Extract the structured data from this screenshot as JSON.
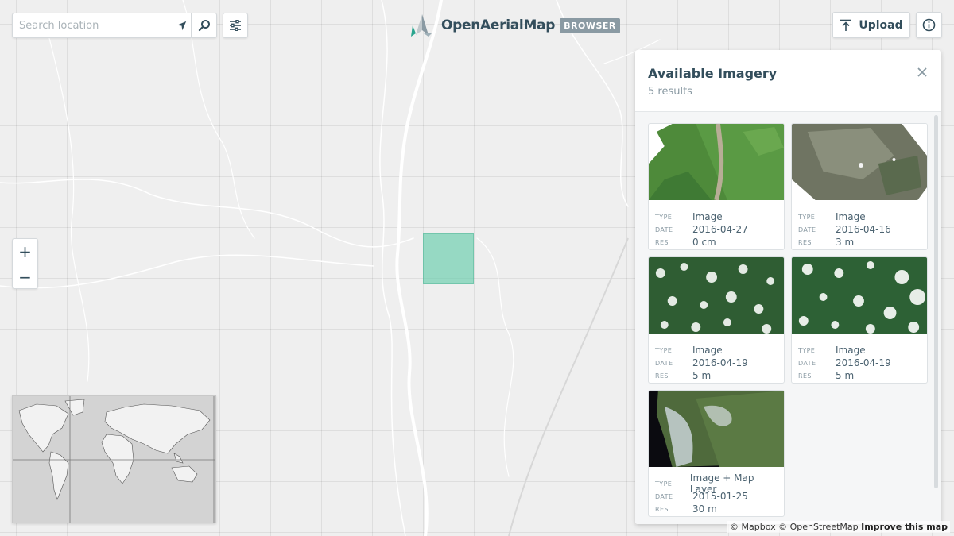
{
  "search": {
    "placeholder": "Search location"
  },
  "brand": {
    "title": "OpenAerialMap",
    "badge": "BROWSER"
  },
  "header": {
    "upload_label": "Upload"
  },
  "panel": {
    "title": "Available Imagery",
    "results": "5 results",
    "labels": {
      "type": "TYPE",
      "date": "DATE",
      "res": "RES"
    },
    "items": [
      {
        "type": "Image",
        "date": "2016-04-27",
        "res": "0 cm"
      },
      {
        "type": "Image",
        "date": "2016-04-16",
        "res": "3 m"
      },
      {
        "type": "Image",
        "date": "2016-04-19",
        "res": "5 m"
      },
      {
        "type": "Image",
        "date": "2016-04-19",
        "res": "5 m"
      },
      {
        "type": "Image + Map Layer",
        "date": "2015-01-25",
        "res": "30 m"
      }
    ]
  },
  "attribution": {
    "mapbox": "© Mapbox",
    "osm": "© OpenStreetMap",
    "improve": "Improve this map"
  },
  "colors": {
    "brand_text": "#334e5c",
    "selection": "#66cdaa",
    "badge": "#8a9aa3"
  },
  "icons": [
    "locate-arrow-icon",
    "search-icon",
    "filter-sliders-icon",
    "oam-logo-icon",
    "upload-icon",
    "info-icon",
    "close-icon"
  ]
}
